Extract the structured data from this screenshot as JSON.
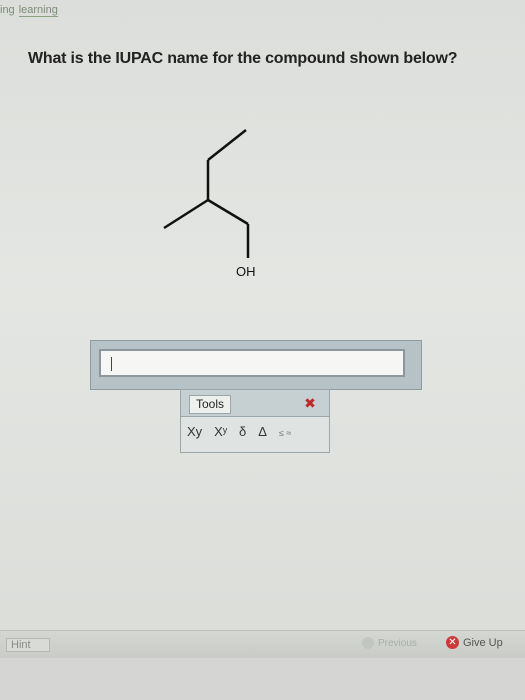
{
  "nav": {
    "tab_partial": "ing",
    "tab_learning": "learning"
  },
  "question": {
    "text": "What is the IUPAC name for the compound shown below?"
  },
  "molecule": {
    "group_label": "OH"
  },
  "answer": {
    "value": ""
  },
  "tools": {
    "label": "Tools",
    "close_icon": "close-icon",
    "subscript": "Xy",
    "superscript": "Xʸ",
    "delta_lower": "δ",
    "delta_upper": "Δ",
    "leq": "≤ ≈"
  },
  "bottom": {
    "hint_label": "Hint",
    "previous_label": "Previous",
    "give_up_label": "Give Up"
  },
  "colors": {
    "accent_red": "#cc3b3b",
    "frame": "#b7c2c7"
  }
}
